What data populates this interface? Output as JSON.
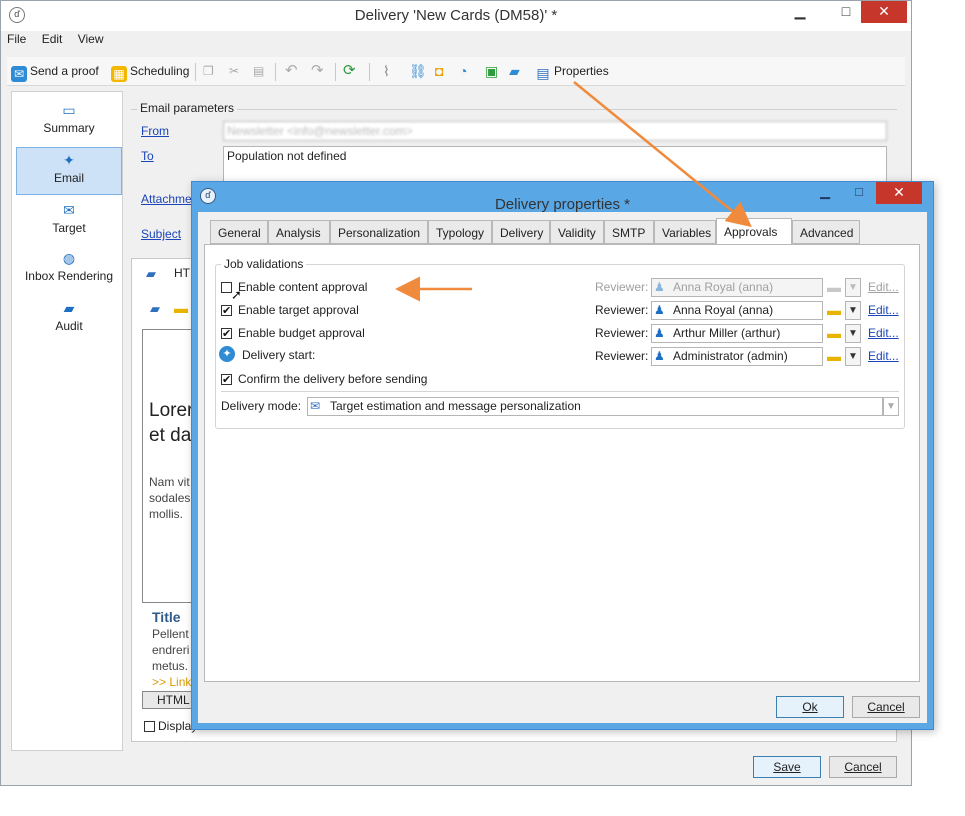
{
  "main_window": {
    "title": "Delivery 'New Cards (DM58)' *",
    "minimize": "▁",
    "maximize": "□",
    "close": "✕",
    "menu": [
      "File",
      "Edit",
      "View"
    ],
    "toolbar": {
      "send_proof": "Send a proof",
      "scheduling": "Scheduling",
      "properties": "Properties"
    },
    "nav": {
      "summary": "Summary",
      "email": "Email",
      "target": "Target",
      "inbox_rendering": "Inbox Rendering",
      "audit": "Audit"
    },
    "email_params": {
      "group_label": "Email parameters",
      "from_label": "From",
      "from_value": "Newsletter <info@newsletter.com>",
      "to_label": "To",
      "to_value": "Population not defined",
      "attachments_label": "Attachme",
      "subject_label": "Subject"
    },
    "preview": {
      "tab_label": "HT",
      "heading_1": "Lorer",
      "heading_2": "et da",
      "para_1": "Nam vit",
      "para_2": "sodales",
      "para_3": "mollis.",
      "title": "Title",
      "body_1": "Pellent",
      "body_2": "endreri",
      "body_3": "metus.",
      "link": ">> Link",
      "bottom_tab": "HTML",
      "display_checkbox": "Display"
    },
    "save": "Save",
    "cancel": "Cancel"
  },
  "dialog": {
    "title": "Delivery properties *",
    "close": "✕",
    "maximize": "□",
    "minimize": "▁",
    "tabs": [
      "General",
      "Analysis",
      "Personalization",
      "Typology",
      "Delivery",
      "Validity",
      "SMTP",
      "Variables",
      "Approvals",
      "Advanced"
    ],
    "active_tab": "Approvals",
    "section": "Job validations",
    "rows": [
      {
        "label": "Enable content approval",
        "checked": false,
        "reviewer_label": "Reviewer:",
        "reviewer": "Anna Royal (anna)",
        "edit": "Edit...",
        "disabled": true
      },
      {
        "label": "Enable target approval",
        "checked": true,
        "reviewer_label": "Reviewer:",
        "reviewer": "Anna Royal (anna)",
        "edit": "Edit...",
        "disabled": false
      },
      {
        "label": "Enable budget approval",
        "checked": true,
        "reviewer_label": "Reviewer:",
        "reviewer": "Arthur Miller (arthur)",
        "edit": "Edit...",
        "disabled": false
      },
      {
        "label": "Delivery start:",
        "checked": null,
        "reviewer_label": "Reviewer:",
        "reviewer": "Administrator (admin)",
        "edit": "Edit...",
        "disabled": false
      }
    ],
    "confirm_label": "Confirm the delivery before sending",
    "confirm_checked": true,
    "delivery_mode_label": "Delivery mode:",
    "delivery_mode_value": "Target estimation and message personalization",
    "ok": "Ok",
    "cancel": "Cancel"
  },
  "colors": {
    "accent_orange": "#f08a3c",
    "dialog_frame": "#5aa7e6",
    "close_red": "#c7362b",
    "link_blue": "#1a44b8"
  }
}
